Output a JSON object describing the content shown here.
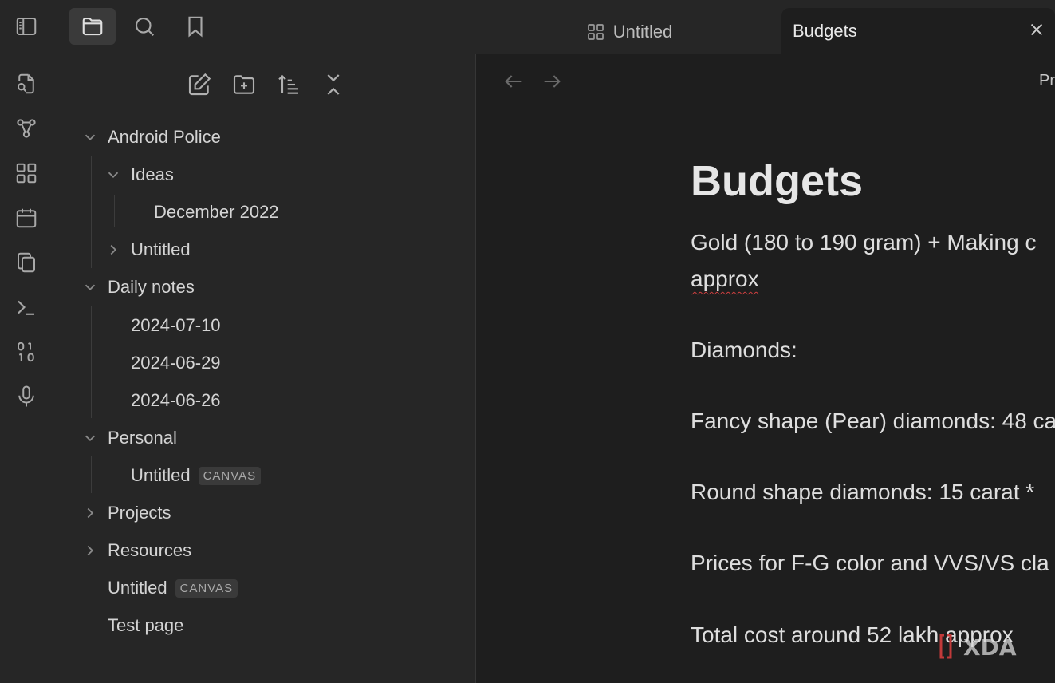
{
  "tabs": {
    "inactive_label": "Untitled",
    "active_label": "Budgets"
  },
  "sidebar": {
    "tree": [
      {
        "label": "Android Police",
        "type": "folder",
        "expanded": true
      },
      {
        "label": "Ideas",
        "type": "folder",
        "expanded": true
      },
      {
        "label": "December 2022",
        "type": "file"
      },
      {
        "label": "Untitled",
        "type": "folder",
        "expanded": false
      },
      {
        "label": "Daily notes",
        "type": "folder",
        "expanded": true
      },
      {
        "label": "2024-07-10",
        "type": "file"
      },
      {
        "label": "2024-06-29",
        "type": "file"
      },
      {
        "label": "2024-06-26",
        "type": "file"
      },
      {
        "label": "Personal",
        "type": "folder",
        "expanded": true
      },
      {
        "label": "Untitled",
        "type": "file",
        "badge": "CANVAS"
      },
      {
        "label": "Projects",
        "type": "folder",
        "expanded": false
      },
      {
        "label": "Resources",
        "type": "folder",
        "expanded": false
      },
      {
        "label": "Untitled",
        "type": "file",
        "badge": "CANVAS"
      },
      {
        "label": "Test page",
        "type": "file"
      }
    ]
  },
  "main": {
    "header_partial": "Pr",
    "title": "Budgets",
    "lines": [
      "Gold (180 to 190 gram) + Making c",
      "approx",
      "Diamonds:",
      "Fancy shape (Pear) diamonds: 48 ca",
      "Round shape diamonds: 15 carat *",
      "Prices for F-G color and VVS/VS cla",
      "Total cost around 52 lakh approx"
    ]
  },
  "watermark": "XDA",
  "colors": {
    "background": "#1e1e1e",
    "panel": "#262626",
    "text": "#dadada",
    "muted": "#8a8a8a",
    "spellcheck": "#d04040"
  }
}
